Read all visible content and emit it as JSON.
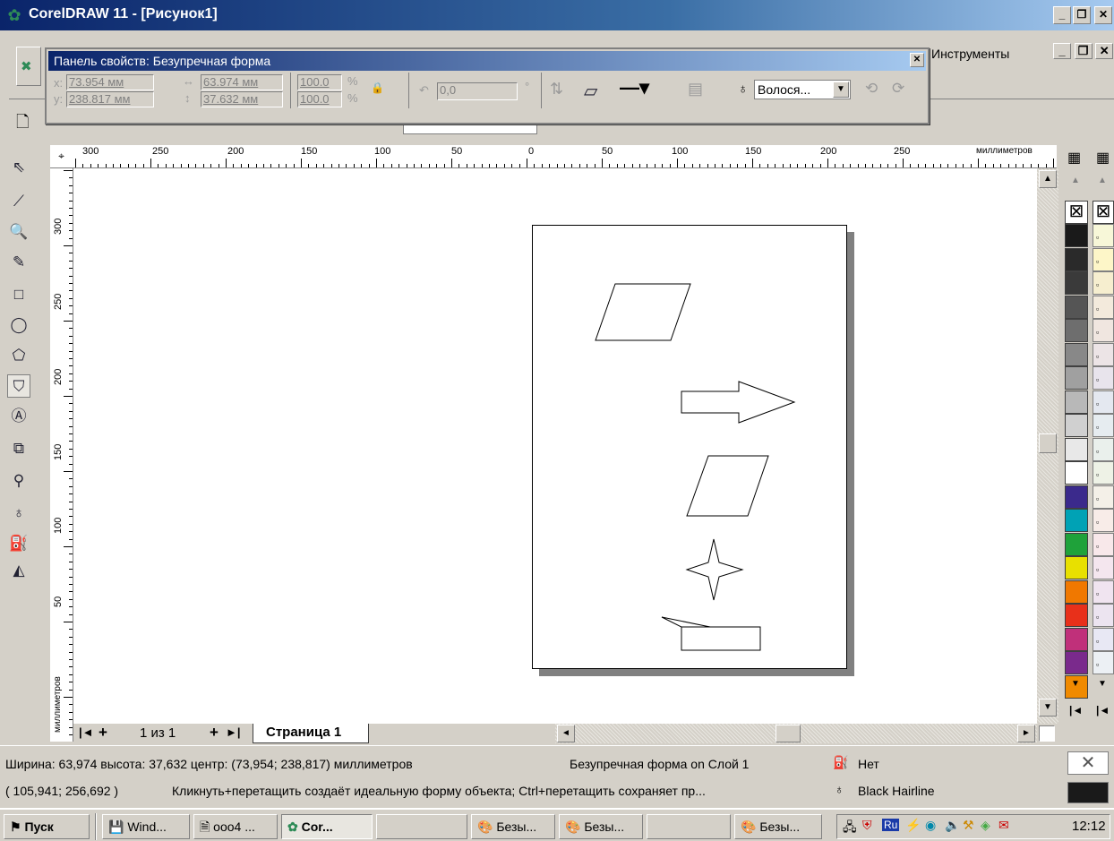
{
  "window": {
    "title": "CorelDRAW 11 - [Рисунок1]",
    "icon": "coreldraw-balloon-icon",
    "buttons": [
      "_",
      "🗗",
      "✕"
    ]
  },
  "menu": {
    "tools": "Инструменты"
  },
  "property_bar": {
    "title": "Панель свойств: Безупречная форма",
    "x_label": "x:",
    "y_label": "y:",
    "x_value": "73.954 мм",
    "y_value": "238.817 мм",
    "width_value": "63.974 мм",
    "height_value": "37.632 мм",
    "scale_x": "100.0",
    "scale_y": "100.0",
    "percent": "%",
    "rotation": "0,0",
    "degree": "°",
    "outline_select": "Волося...",
    "close": "✕"
  },
  "rulers": {
    "unit_label": "миллиметров",
    "h_ticks": [
      "300",
      "250",
      "200",
      "150",
      "100",
      "50",
      "0",
      "50",
      "100",
      "150",
      "200",
      "250"
    ],
    "v_ticks": [
      "300",
      "250",
      "200",
      "150",
      "100",
      "50"
    ],
    "v_unit_label": "миллиметров"
  },
  "page_nav": {
    "first": "|◄",
    "add_before": "+",
    "counter": "1 из 1",
    "add_after": "+",
    "last": "►|",
    "tab": "Страница 1"
  },
  "status": {
    "line1_left": "Ширина: 63,974  высота: 37,632  центр: (73,954; 238,817)  миллиметров",
    "line1_mid": "Безупречная форма on Слой 1",
    "fill": "Нет",
    "line2_left": "( 105,941; 256,692 )",
    "line2_mid": "Кликнуть+перетащить создаёт идеальную форму объекта; Ctrl+перетащить  сохраняет пр...",
    "outline": "Black  Hairline"
  },
  "taskbar": {
    "start": "Пуск",
    "items": [
      "Wind...",
      "ооо4 ...",
      "Cor...",
      "",
      "Безы...",
      "Безы...",
      "",
      "Безы..."
    ],
    "clock": "12:12",
    "lang": "Ru"
  },
  "palette": {
    "colors": [
      "#1a1a1a",
      "#2a2a2a",
      "#3a3a3a",
      "#555555",
      "#6e6e6e",
      "#888888",
      "#a0a0a0",
      "#b8b8b8",
      "#d0d0d0",
      "#e8e8e8",
      "#ffffff",
      "#3b2a8c",
      "#00a2b5",
      "#1fa23a",
      "#e8e000",
      "#f07800",
      "#e8301a",
      "#c0307a",
      "#7a2a8c",
      "#f08a00"
    ],
    "colors2": [
      "#f7f7d8",
      "#fdf6c8",
      "#f6eecf",
      "#f3eadc",
      "#f0e6e0",
      "#ece4e6",
      "#e8e4ec",
      "#e4e8f0",
      "#e6ecf0",
      "#eaf0ec",
      "#eef2e6",
      "#f4f0e8",
      "#f8ece8",
      "#f8e8ea",
      "#f4e6ee",
      "#f0e4f0",
      "#ece4f0",
      "#e8e8f4",
      "#ecf0f4"
    ]
  }
}
